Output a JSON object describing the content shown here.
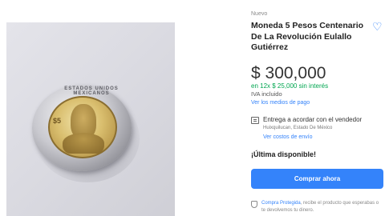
{
  "product": {
    "condition": "Nuevo",
    "title": "Moneda 5 Pesos Centenario De La Revolución Eulallo Gutiérrez",
    "price": "$ 300,000",
    "installments": "en 12x $ 25,000 sin interés",
    "tax_note": "IVA incluido",
    "payment_methods_link": "Ver los medios de pago",
    "coin_inscription": "ESTADOS UNIDOS MEXICANOS",
    "coin_denomination": "$5"
  },
  "shipping": {
    "text": "Entrega a acordar con el vendedor",
    "location": "Huixquilucan, Estado De México",
    "costs_link": "Ver costos de envío"
  },
  "stock": {
    "label": "¡Última disponible!"
  },
  "actions": {
    "buy_label": "Comprar ahora"
  },
  "protection": {
    "link": "Compra Protegida",
    "text": ", recibe el producto que esperabas o te devolvemos tu dinero."
  },
  "colors": {
    "accent": "#3483fa",
    "installments": "#00a650"
  },
  "icons": {
    "favorite": "heart-icon",
    "shipping": "package-icon",
    "protection": "shield-icon"
  }
}
